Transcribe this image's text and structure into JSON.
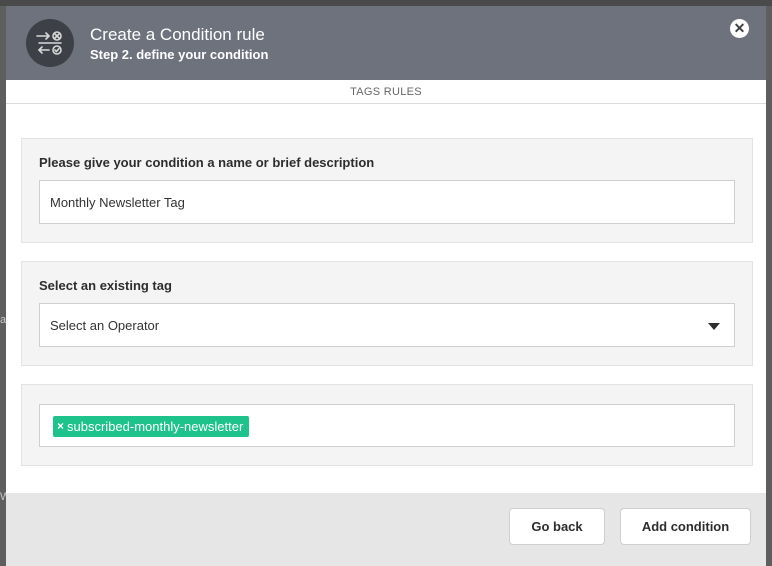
{
  "background": {
    "left_fragment_1": "a",
    "left_fragment_2": "W",
    "bottom_tab": "•••"
  },
  "modal": {
    "title": "Create a Condition rule",
    "subtitle": "Step 2. define your condition",
    "icon": "condition-rule-icon",
    "close_icon": "close-icon",
    "close_glyph": "✕"
  },
  "tabs": {
    "active": "TAGS RULES"
  },
  "name_section": {
    "label": "Please give your condition a name or brief description",
    "value": "Monthly Newsletter Tag"
  },
  "tag_section": {
    "label": "Select an existing tag",
    "select_value": "Select an Operator",
    "dropdown_icon": "caret-down-icon"
  },
  "selected_tags": {
    "remove_glyph": "×",
    "items": [
      {
        "label": "subscribed-monthly-newsletter"
      }
    ]
  },
  "footer": {
    "back_label": "Go back",
    "add_label": "Add condition"
  },
  "colors": {
    "header": "#6d727c",
    "icon_circle": "#3d4046",
    "tag_chip": "#1ec28b",
    "panel": "#f4f4f4",
    "footer": "#e6e6e6"
  }
}
